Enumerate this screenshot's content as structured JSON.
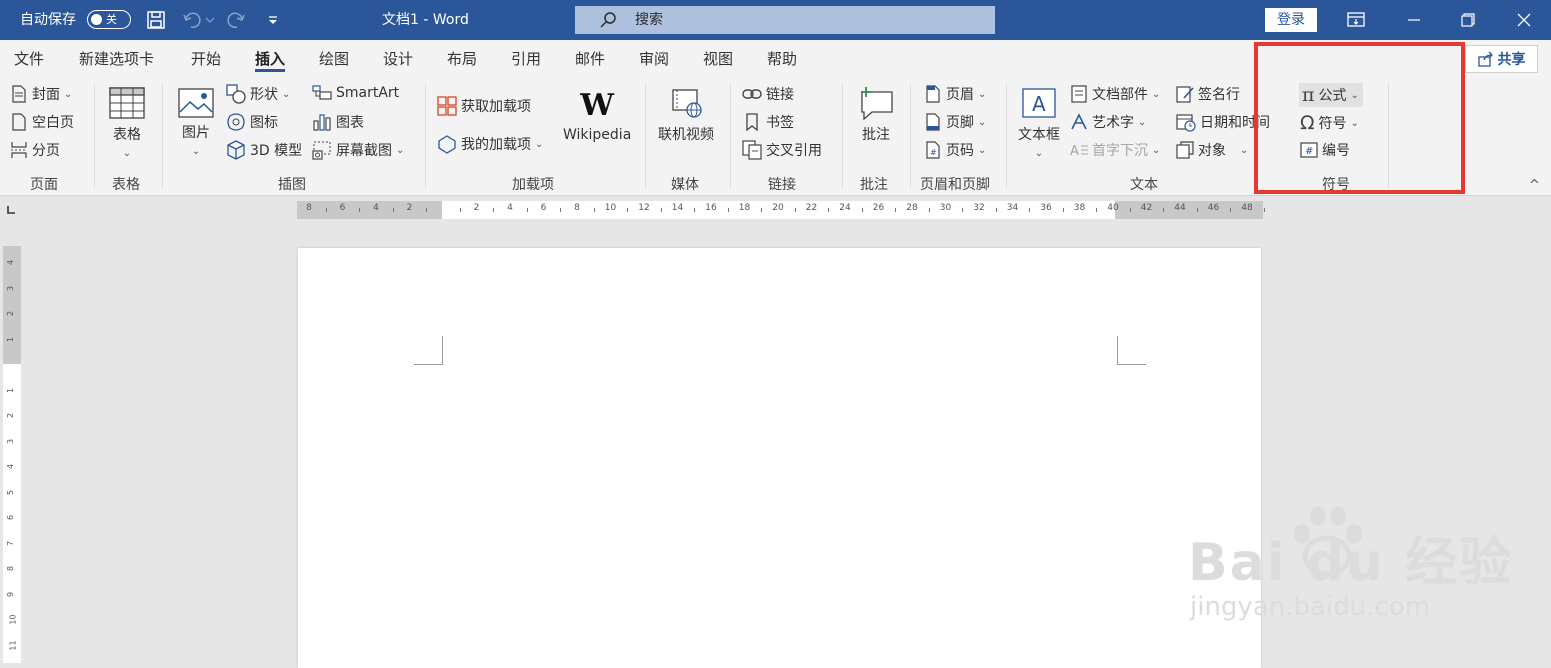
{
  "titlebar": {
    "autosave_label": "自动保存",
    "autosave_state": "关",
    "doc_title": "文档1  -  Word",
    "search_placeholder": "搜索",
    "login_label": "登录"
  },
  "tabs": [
    "文件",
    "新建选项卡",
    "开始",
    "插入",
    "绘图",
    "设计",
    "布局",
    "引用",
    "邮件",
    "审阅",
    "视图",
    "帮助"
  ],
  "active_tab": "插入",
  "share_label": "共享",
  "ribbon": {
    "pages": {
      "cover": "封面",
      "blank": "空白页",
      "break": "分页",
      "group": "页面"
    },
    "tables": {
      "table": "表格",
      "group": "表格"
    },
    "illustrations": {
      "picture": "图片",
      "shapes": "形状",
      "icons": "图标",
      "model3d": "3D 模型",
      "smartart": "SmartArt",
      "chart": "图表",
      "screenshot": "屏幕截图",
      "group": "插图"
    },
    "addins": {
      "get": "获取加载项",
      "my": "我的加载项",
      "wikipedia": "Wikipedia",
      "group": "加载项"
    },
    "media": {
      "video": "联机视频",
      "group": "媒体"
    },
    "links": {
      "link": "链接",
      "bookmark": "书签",
      "crossref": "交叉引用",
      "group": "链接"
    },
    "comments": {
      "comment": "批注",
      "group": "批注"
    },
    "headerfooter": {
      "header": "页眉",
      "footer": "页脚",
      "pagenum": "页码",
      "group": "页眉和页脚"
    },
    "text": {
      "textbox": "文本框",
      "parts": "文档部件",
      "wordart": "艺术字",
      "dropcap": "首字下沉",
      "signature": "签名行",
      "datetime": "日期和时间",
      "object": "对象",
      "group": "文本"
    },
    "symbols": {
      "equation": "公式",
      "symbol": "符号",
      "number": "编号",
      "group": "符号"
    }
  },
  "ruler": {
    "labels": [
      "8",
      "6",
      "4",
      "2",
      "",
      "2",
      "4",
      "6",
      "8",
      "10",
      "12",
      "14",
      "16",
      "18",
      "20",
      "22",
      "24",
      "26",
      "28",
      "30",
      "32",
      "34",
      "36",
      "38",
      "40",
      "42",
      "44",
      "46",
      "48"
    ],
    "vlabels": [
      "4",
      "3",
      "2",
      "1",
      "",
      "1",
      "2",
      "3",
      "4",
      "5",
      "6",
      "7",
      "8",
      "9",
      "10",
      "11"
    ]
  },
  "watermark": {
    "logo": "Bai du 经验",
    "url": "jingyan.baidu.com"
  }
}
